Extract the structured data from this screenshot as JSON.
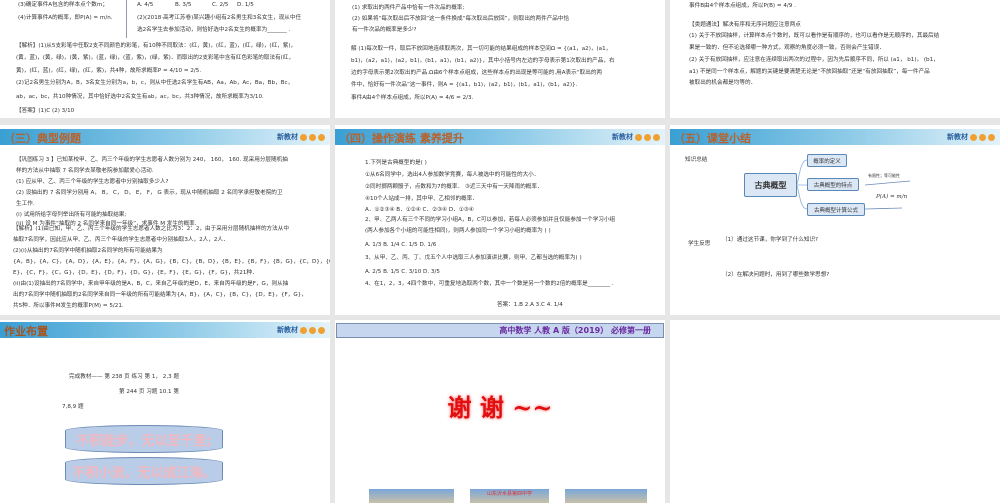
{
  "slide1": {
    "lines": [
      "(3)确定事件A包含的样本点个数m；",
      "(4)计算事件A的概率，即P(A) = m/n."
    ],
    "options": [
      "A. 4/5",
      "B. 3/5",
      "C. 2/5",
      "D. 1/5"
    ],
    "q2": [
      "(2)(2018·高考江苏卷)某兴趣小组有2名男生和3名女生，现从中任",
      "选2名学生去参加活动，则恰好选中2名女生的概率为_______ ."
    ],
    "solution": [
      "【解析】(1)从5支彩笔中任取2支不同颜色的彩笔，有10种不同取法：(红，黄)，(红，蓝)，(红，绿)，(红，紫)，",
      "(黄，蓝)，(黄，绿)，(黄，紫)，(蓝，绿)，(蓝，紫)，(绿，紫)．而取出的2支彩笔中含有红色彩笔的取法有(红，",
      "黄)，(红，蓝)，(红，绿)，(红，紫)，共4种，故所求概率P = 4/10 = 2/5.",
      "(2)记2名男生分别为A，B，3名女生分别为a，b，c，则从中任选2名学生有AB，Aa，Ab，Ac，Ba，Bb，Bc，",
      "ab，ac，bc，共10种情况，其中恰好选中2名女生有ab，ac，bc，共3种情况，故所求概率为3/10.",
      "【答案】(1)C   (2) 3/10"
    ]
  },
  "slide2": {
    "lines": [
      "(1) 求取出的两件产品中恰有一件次品的概率;",
      "(2) 如果将“每次取出后不放回”这一条件换成“每次取出后放回”，则取出的两件产品中恰",
      "有一件次品的概率是多少?",
      "解   (1)每次取一件，取后不放回地连续取两次，其一切可能的结果组成的样本空间Ω = {(a1，a2)，(a1，",
      "b1)，(a2，a1)，(a2，b1)，(b1，a1)，(b1，a2)}，其中小括号内左边的字母表示第1次取出的产品，右",
      "边的字母表示第2次取出的产品.Ω由6个样本点组成，这些样本点的出现是等可能的.用A表示“取出的两",
      "件中，恰好有一件次品”这一事件，则A = {(a1，b1)，(a2，b1)，(b1，a1)，(b1，a2)}.",
      "事件A由4个样本点组成，所以P(A) = 4/6 = 2/3."
    ]
  },
  "slide3": {
    "lines": [
      "事件B由4个样本点组成，所以P(B) = 4/9 .",
      "【类题通法】解决有序和无序问题应注意两点",
      "(1) 关于不放回抽样，计算样本点个数时，既可以看作是有顺序的，也可以看作是无顺序的，其最后结",
      "果是一致的．但不论选择哪一种方式，观察的角度必须一致，否则会产生错误．",
      "(2) 关于有放回抽样，应注意在连续取出两次的过程中，因为先后顺序不同，所以 (a1， b1)， (b1，",
      "a1) 不是同一个样本点，解题的关键是要清楚无论是“不放回抽取”还是“有放回抽取”，每一件产品",
      "被取出的机会都是均等的．"
    ]
  },
  "brand": "新教材",
  "slide4": {
    "title": "（三）典型例题",
    "lines": [
      "【巩固练习 3 】已知某校甲、乙、丙三个年级的学生志愿者人数分别为 240， 160， 160. 现采用分层随机抽",
      "样的方法从中抽取 7 名同学去某敬老院参加献爱心活动.",
      "(1) 应从甲、乙、丙三个年级的学生志愿者中分别抽取多少人?",
      "(2) 设抽出的 7 名同学分别用 A， B， C， D， E， F， G 表示，现从中随机抽取 2 名同学承担敬老院的卫",
      "生工作.",
      "(i) 试用所给字母列举出所有可能的抽取结果;",
      "(ii) 设 M 为事件“抽取的 2 名同学来自同一年级”，求事件 M 发生的概率.",
      "【解析】(1)由已知，甲、乙、丙三个年级的学生志愿者人数之比为3：2：2，由于采用分层随机抽样的方法从中",
      "抽取7名同学，因此应从甲、乙、丙三个年级的学生志愿者中分别抽取3人，2人，2人．",
      "(2)(i)从抽出的7名同学中随机抽取2名同学的所有可能结果为",
      "{A，B}，{A，C}，{A，D}，{A，E}，{A，F}，{A，G}，{B，C}，{B，D}，{B，E}，{B，F}，{B，G}，{C，D}，{C，",
      "E}，{C，F}，{C，G}，{D，E}，{D，F}，{D，G}，{E，F}，{E，G}，{F，G}，共21种．",
      "(ii)由(1)设抽出的7名同学中，来自甲年级的是A，B，C，来自乙年级的是D，E，来自丙年级的是F，G，则从抽",
      "出的7名同学中随机抽取的2名同学来自同一年级的所有可能结果为{A，B}，{A，C}，{B，C}，{D，E}，{F，G}，",
      "共5种．所以事件M发生的概率P(M) = 5/21."
    ]
  },
  "slide5": {
    "title": "（四）操作演练 素养提升",
    "lines": [
      "1.下列是古典概型的是(       )",
      "①从6名同学中，选出4人参加数学竞赛，每人被选中的可能性的大小．",
      "②同时掷两颗骰子，点数和为7的概率．        ③近三天中有一天降雨的概率．",
      "④10个人站成一排，其中甲、乙相邻的概率．",
      "A．①②③④          B．①②④     C．②③④               D．①③④",
      "2、甲、乙两人有三个不同的学习小组A，B，C可以参加，若每人必须参加并且仅能参加一个学习小组",
      "(两人参加各个小组的可能性相同)，则两人参加同一个学习小组的概率为    (       )",
      "A.  1/3          B. 1/4     C.  1/5               D. 1/6",
      "3、从甲、乙、丙、丁、戊五个人中选取三人参加演讲比赛，则甲、乙都当选的概率为(        )",
      "A.  2/5          B. 1/5     C.  3/10       D.  3/5",
      "4、在1，2，3，4四个数中，可重复地选取两个数，其中一个数是另一个数的2倍的概率是________ ."
    ],
    "answer": "答案：1.B  2.A  3.C  4. 1/4"
  },
  "slide6": {
    "title": "（五）课堂小结",
    "knowledge_label": "知识总结",
    "center": "古典概型",
    "branches": [
      "概率的定义",
      "古典概型的特点",
      "古典概型计算公式"
    ],
    "feature_note": "有限性；等可能性",
    "formula": "P(A) = m/n",
    "reflection_label": "学生反思",
    "reflections": [
      "（1）通过这节课，你学到了什么知识?",
      "（2）在解决问题时，用到了哪些数学思想?"
    ]
  },
  "slide7": {
    "title": "作业布置",
    "lines": [
      "完成教材—— 第 238 页  练习    第 1， 2,3 题",
      "第 244 页   习题 10.1   第",
      "7,8,9 题"
    ],
    "banners": [
      "不积跬步，无以至千里;",
      "不积小流，无以成江海。"
    ]
  },
  "slide8": {
    "header": "高中数学    人教 A 版（2019）  必修第一册",
    "thanks": "谢  谢  ~~",
    "school": "山东沂水县第四中学"
  }
}
